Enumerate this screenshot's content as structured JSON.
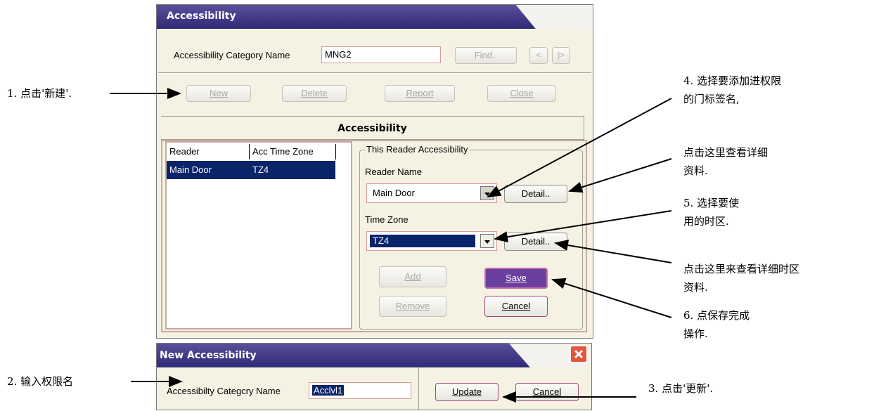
{
  "main_dialog": {
    "title": "Accessibility",
    "category_label": "Accessibility Category Name",
    "category_value": "MNG2",
    "find_label": "Find..",
    "nav_prev": "<",
    "nav_next": "|>",
    "buttons": {
      "new": "New",
      "delete": "Delete",
      "report": "Report",
      "close": "Close"
    },
    "section_title": "Accessibility",
    "table": {
      "headers": [
        "Reader",
        "Acc Time Zone"
      ],
      "rows": [
        [
          "Main Door",
          "TZ4"
        ]
      ]
    },
    "group_title": "This Reader Accessibility",
    "reader_name_label": "Reader Name",
    "reader_name_value": "Main Door",
    "time_zone_label": "Time Zone",
    "time_zone_value": "TZ4",
    "detail_label": "Detail..",
    "add_label": "Add",
    "remove_label": "Remove",
    "save_label": "Save",
    "cancel_label": "Cancel"
  },
  "new_dialog": {
    "title": "New Accessibility",
    "category_label": "Accessibilty Categcry Name",
    "category_value": "Acclvl1",
    "update_label": "Update",
    "cancel_label": "Cancel"
  },
  "annotations": {
    "step1": "1. 点击'新建'.",
    "step2": "2. 输入权限名",
    "step3": "3. 点击'更新'.",
    "step4_line1": "4. 选择要添加进权限",
    "step4_line2": "的门标签名,",
    "detail1_line1": "点击这里查看详细",
    "detail1_line2": "资料.",
    "step5_line1": "5. 选择要使",
    "step5_line2": "用的时区.",
    "detail2_line1": "点击这里来查看详细时区",
    "detail2_line2": "资料.",
    "step6_line1": "6. 点保存完成",
    "step6_line2": "操作."
  },
  "colors": {
    "title_bar": "#2e2a78",
    "selection": "#0a246a",
    "save_button": "#6a3fa0",
    "close_button": "#e2553a"
  }
}
